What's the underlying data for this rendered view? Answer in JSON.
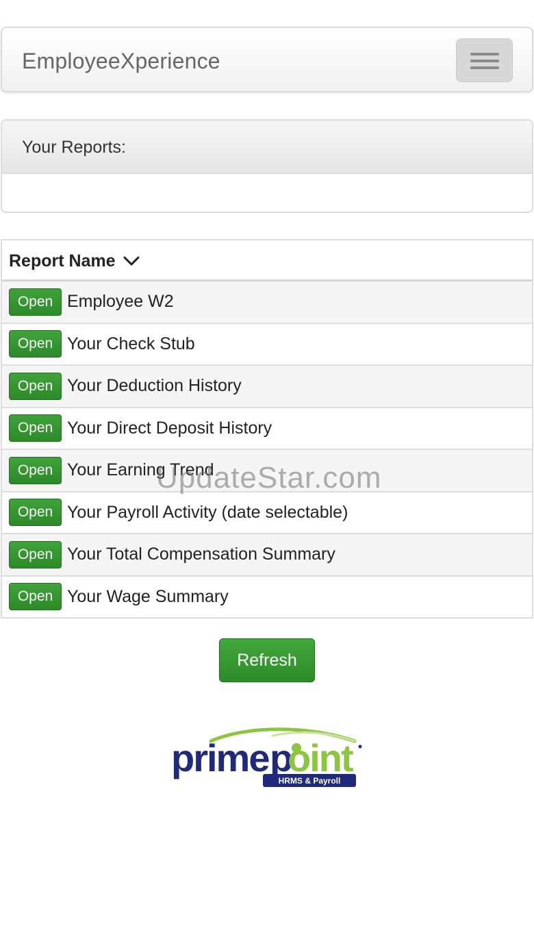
{
  "header": {
    "brand": "EmployeeXperience",
    "menu_icon": "hamburger-menu-icon"
  },
  "reports_panel": {
    "title": "Your Reports:"
  },
  "table": {
    "column_header": "Report Name",
    "sort_icon": "chevron-down-icon",
    "open_label": "Open",
    "rows": [
      {
        "name": "Employee W2"
      },
      {
        "name": "Your Check Stub"
      },
      {
        "name": "Your Deduction History"
      },
      {
        "name": "Your Direct Deposit History"
      },
      {
        "name": "Your Earning Trend"
      },
      {
        "name": "Your Payroll Activity (date selectable)"
      },
      {
        "name": "Your Total Compensation Summary"
      },
      {
        "name": "Your Wage Summary"
      }
    ]
  },
  "refresh_label": "Refresh",
  "watermark": "UpdateStar.com",
  "logo": {
    "text": "primepoint",
    "subtext": "HRMS & Payroll"
  },
  "colors": {
    "accent_green": "#2e8b2a",
    "logo_navy": "#1f2a7a",
    "logo_green": "#8cc63f"
  }
}
